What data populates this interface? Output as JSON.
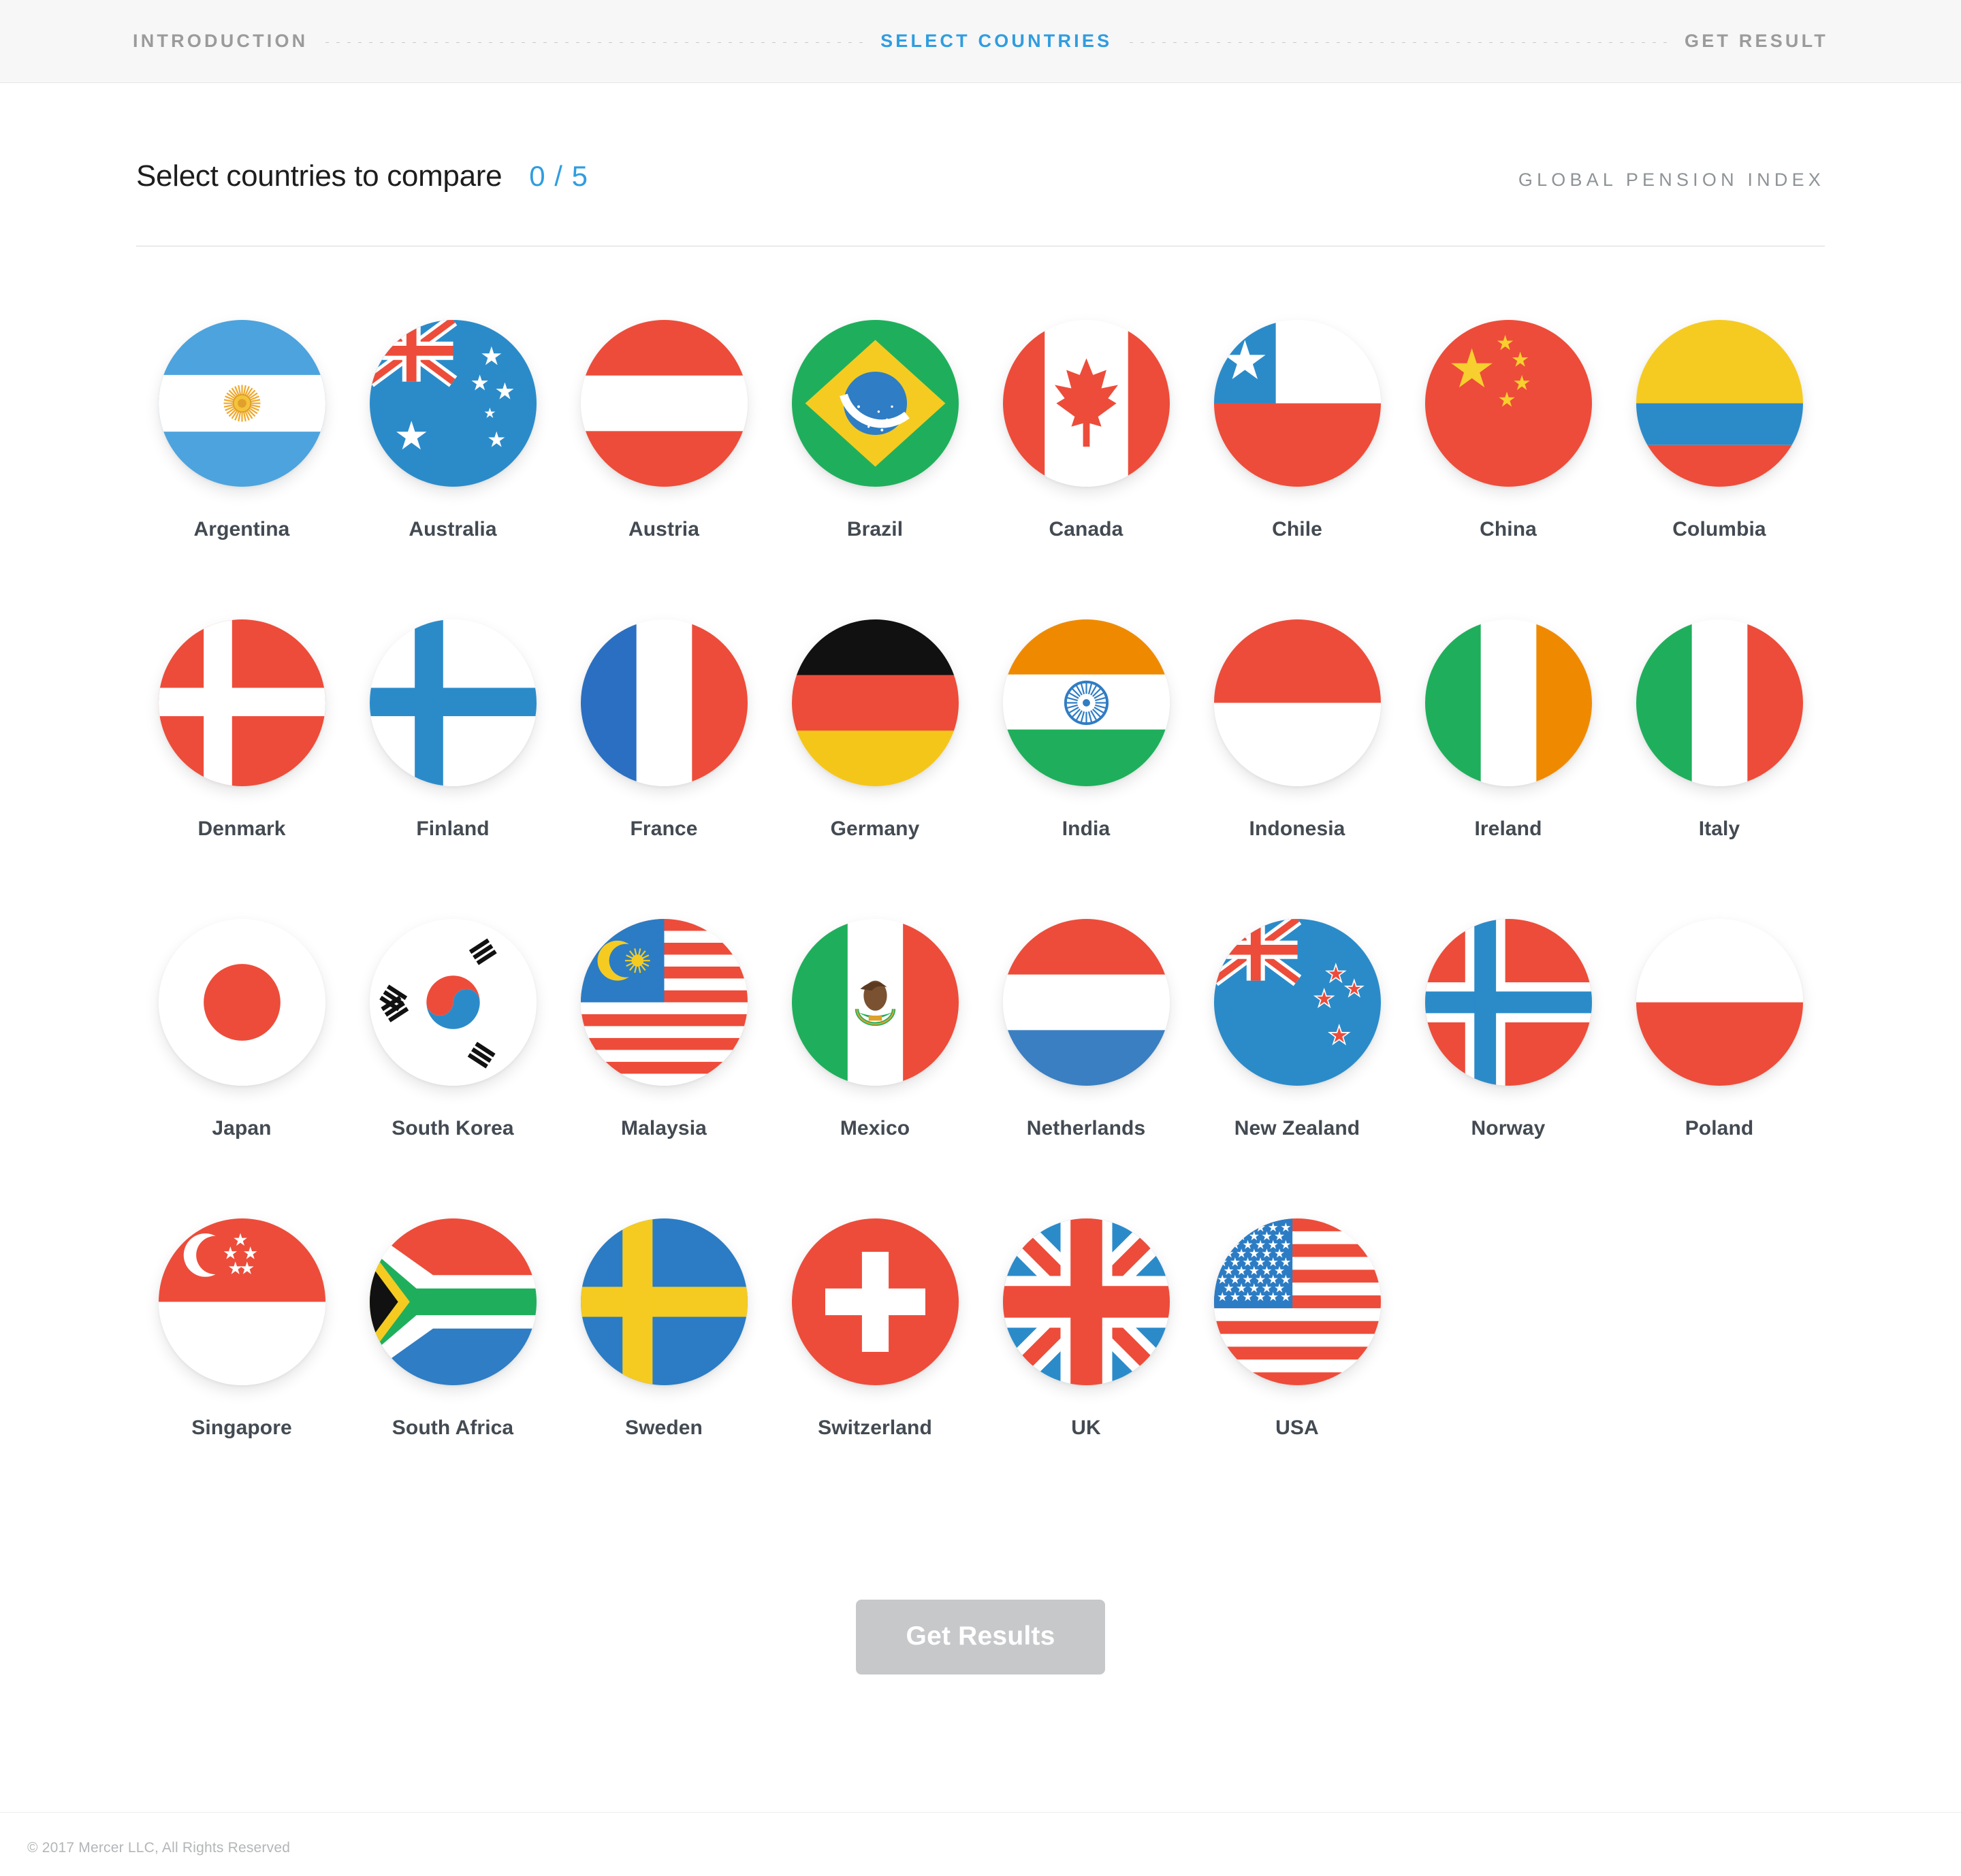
{
  "steps": [
    {
      "label": "INTRODUCTION",
      "active": false
    },
    {
      "label": "SELECT COUNTRIES",
      "active": true
    },
    {
      "label": "GET RESULT",
      "active": false
    }
  ],
  "header": {
    "title": "Select countries to compare",
    "count": "0 / 5",
    "brand": "GLOBAL PENSION INDEX"
  },
  "colors": {
    "accent": "#2f9de0",
    "red": "#ed4c3a",
    "blue": "#2b8bc9",
    "green": "#1faf5c",
    "yellow": "#f5cb21",
    "orange": "#ef8a00",
    "black": "#111111",
    "white": "#ffffff",
    "muted": "#9b9b9b",
    "label": "#434a52",
    "button_disabled": "#c6c8ca"
  },
  "countries": [
    {
      "name": "Argentina",
      "flag": "argentina"
    },
    {
      "name": "Australia",
      "flag": "australia"
    },
    {
      "name": "Austria",
      "flag": "austria"
    },
    {
      "name": "Brazil",
      "flag": "brazil"
    },
    {
      "name": "Canada",
      "flag": "canada"
    },
    {
      "name": "Chile",
      "flag": "chile"
    },
    {
      "name": "China",
      "flag": "china"
    },
    {
      "name": "Columbia",
      "flag": "columbia"
    },
    {
      "name": "Denmark",
      "flag": "denmark"
    },
    {
      "name": "Finland",
      "flag": "finland"
    },
    {
      "name": "France",
      "flag": "france"
    },
    {
      "name": "Germany",
      "flag": "germany"
    },
    {
      "name": "India",
      "flag": "india"
    },
    {
      "name": "Indonesia",
      "flag": "indonesia"
    },
    {
      "name": "Ireland",
      "flag": "ireland"
    },
    {
      "name": "Italy",
      "flag": "italy"
    },
    {
      "name": "Japan",
      "flag": "japan"
    },
    {
      "name": "South Korea",
      "flag": "south-korea"
    },
    {
      "name": "Malaysia",
      "flag": "malaysia"
    },
    {
      "name": "Mexico",
      "flag": "mexico"
    },
    {
      "name": "Netherlands",
      "flag": "netherlands"
    },
    {
      "name": "New Zealand",
      "flag": "new-zealand"
    },
    {
      "name": "Norway",
      "flag": "norway"
    },
    {
      "name": "Poland",
      "flag": "poland"
    },
    {
      "name": "Singapore",
      "flag": "singapore"
    },
    {
      "name": "South Africa",
      "flag": "south-africa"
    },
    {
      "name": "Sweden",
      "flag": "sweden"
    },
    {
      "name": "Switzerland",
      "flag": "switzerland"
    },
    {
      "name": "UK",
      "flag": "uk"
    },
    {
      "name": "USA",
      "flag": "usa"
    }
  ],
  "actions": {
    "get_results_label": "Get Results",
    "get_results_enabled": false
  },
  "footer": {
    "copyright": "© 2017 Mercer LLC, All Rights Reserved"
  }
}
